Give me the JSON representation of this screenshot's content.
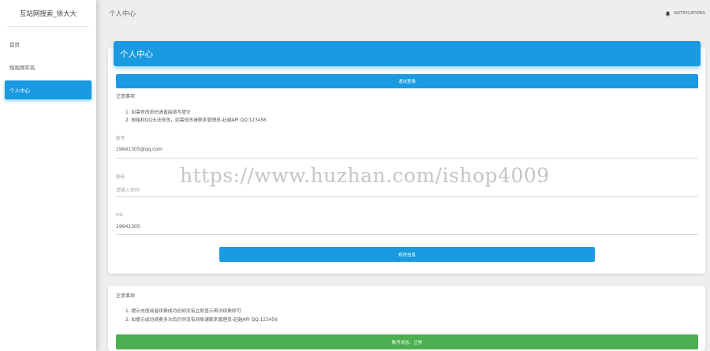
{
  "sidebar": {
    "brand": "互站网搜索_徐大大",
    "items": [
      {
        "label": "首页"
      },
      {
        "label": "短视频实名"
      },
      {
        "label": "个人中心"
      }
    ]
  },
  "header": {
    "title": "个人中心",
    "notifications_label": "NOTIFICATIONS"
  },
  "profile_card": {
    "title": "个人中心",
    "logout_label": "退出登录",
    "notice_title": "注意事项",
    "notices": [
      "1. 如需修改密码请直接填写提交",
      "2. 邮箱和QQ无法修改，如需修改请联系管理员-赶越API QQ:123456"
    ],
    "account_label": "账号",
    "account_value": "19641305@qq.com",
    "password_label": "密码",
    "password_placeholder": "请输入密码",
    "qq_label": "QQ",
    "qq_value": "19641305",
    "submit_label": "修改信息"
  },
  "status_card": {
    "notice_title": "注意事项",
    "notices": [
      "1. 提示充值或者续费成功但却没有立即显示再次续费即可",
      "2. 如提示成功续费多次后仍然没有到账请联系管理员-赶越API QQ:123456"
    ],
    "status_label": "账号状态：正常"
  },
  "watermark": "https://www.huzhan.com/ishop4009",
  "colors": {
    "primary": "#1a9ae0",
    "success": "#4caf50",
    "background": "#eeeeee"
  }
}
